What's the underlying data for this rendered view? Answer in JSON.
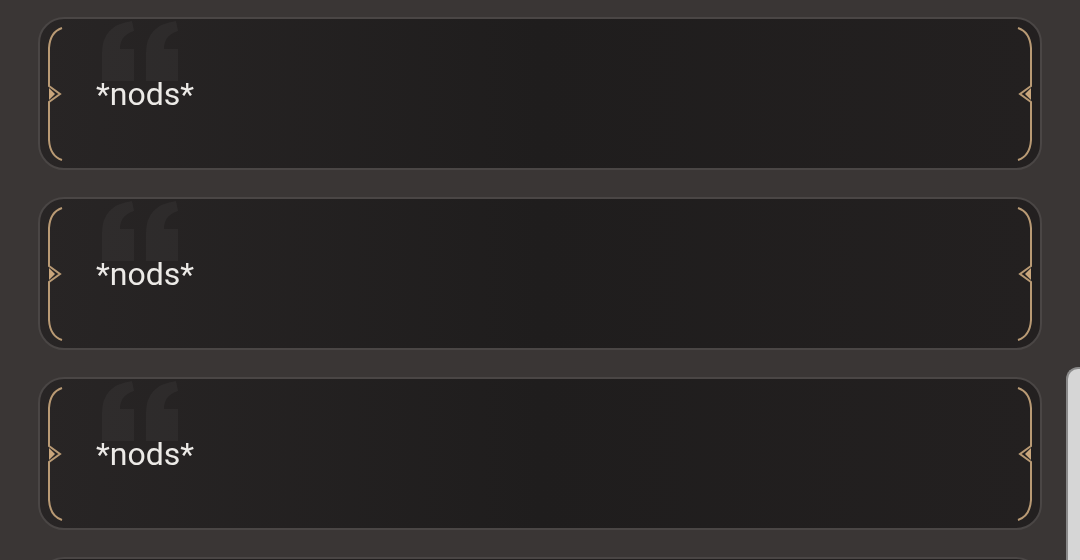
{
  "options": [
    {
      "text": "*nods*"
    },
    {
      "text": "*nods*"
    },
    {
      "text": "*nods*"
    }
  ]
}
